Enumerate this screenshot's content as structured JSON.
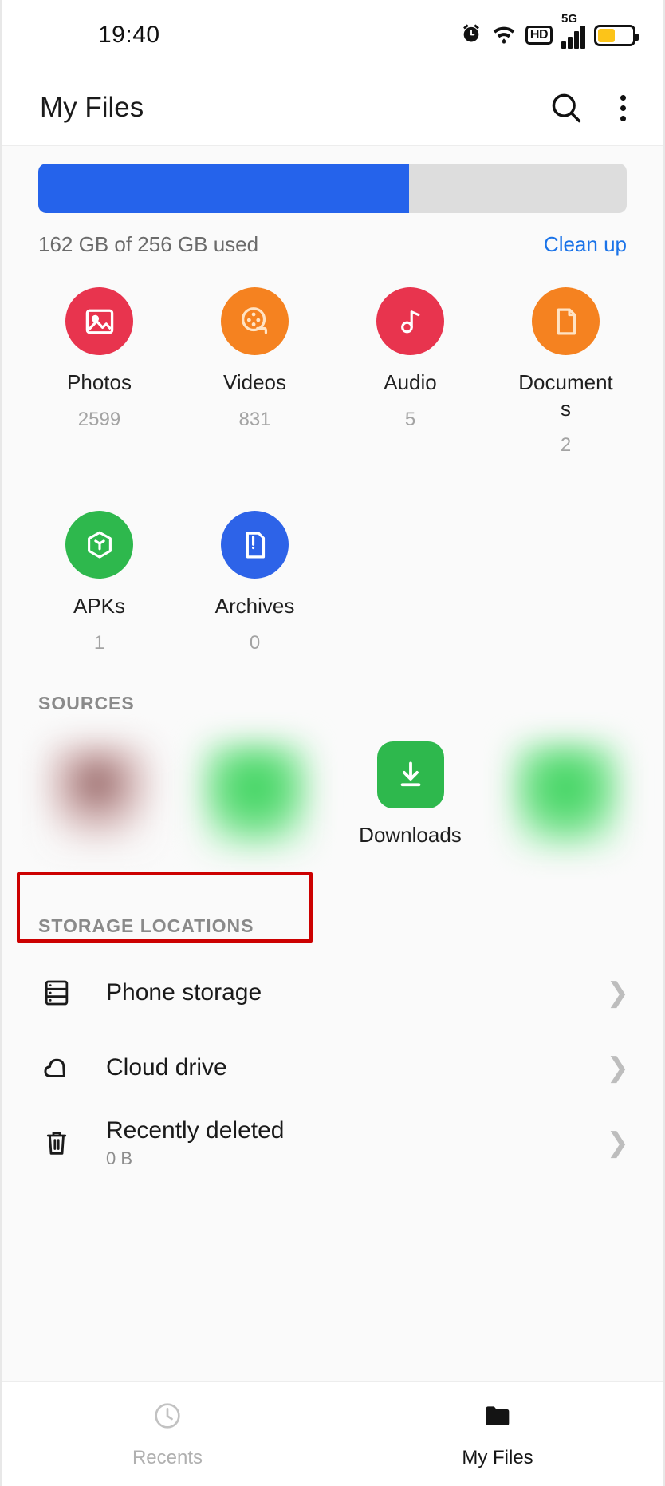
{
  "status_bar": {
    "time": "19:40",
    "icons": [
      "alarm-icon",
      "wifi-icon",
      "hd-icon",
      "5g-signal-icon",
      "battery-icon"
    ],
    "hd_label": "HD",
    "network_label": "5G",
    "battery_level_percent": 50,
    "battery_color": "#fcc419"
  },
  "app_bar": {
    "title": "My Files",
    "search_label": "Search",
    "more_label": "More options"
  },
  "storage": {
    "used_percent": 63,
    "bar_color": "#2563eb",
    "track_color": "#dddddd",
    "usage_text": "162 GB of 256 GB used",
    "clean_up_label": "Clean up",
    "clean_up_color": "#1a73e8"
  },
  "categories": [
    {
      "label": "Photos",
      "count": "2599",
      "color": "#e8344e",
      "icon": "image-icon"
    },
    {
      "label": "Videos",
      "count": "831",
      "color": "#f58220",
      "icon": "film-reel-icon"
    },
    {
      "label": "Audio",
      "count": "5",
      "color": "#e8344e",
      "icon": "music-note-icon"
    },
    {
      "label": "Documents",
      "count": "2",
      "color": "#f58220",
      "icon": "document-icon"
    },
    {
      "label": "APKs",
      "count": "1",
      "color": "#2eb84d",
      "icon": "package-cube-icon"
    },
    {
      "label": "Archives",
      "count": "0",
      "color": "#2d63e8",
      "icon": "archive-file-icon"
    }
  ],
  "sources": {
    "section_title": "SOURCES",
    "items": [
      {
        "label": "",
        "blurred": true,
        "color": "#c79a9a",
        "icon": "blurred-source-icon"
      },
      {
        "label": "",
        "blurred": true,
        "color": "#4ade5f",
        "icon": "blurred-source-icon"
      },
      {
        "label": "Downloads",
        "blurred": false,
        "color": "#2eb84d",
        "icon": "download-icon"
      },
      {
        "label": "",
        "blurred": true,
        "color": "#4ade5f",
        "icon": "blurred-source-icon"
      }
    ]
  },
  "storage_locations": {
    "section_title": "STORAGE LOCATIONS",
    "items": [
      {
        "label": "Phone storage",
        "sub": "",
        "icon": "server-stack-icon",
        "highlighted": true
      },
      {
        "label": "Cloud drive",
        "sub": "",
        "icon": "cloud-icon",
        "highlighted": false
      },
      {
        "label": "Recently deleted",
        "sub": "0 B",
        "icon": "trash-icon",
        "highlighted": false
      }
    ],
    "highlight_color": "#cc0000"
  },
  "bottom_nav": {
    "items": [
      {
        "label": "Recents",
        "icon": "clock-icon",
        "active": false
      },
      {
        "label": "My Files",
        "icon": "folder-icon",
        "active": true
      }
    ]
  }
}
